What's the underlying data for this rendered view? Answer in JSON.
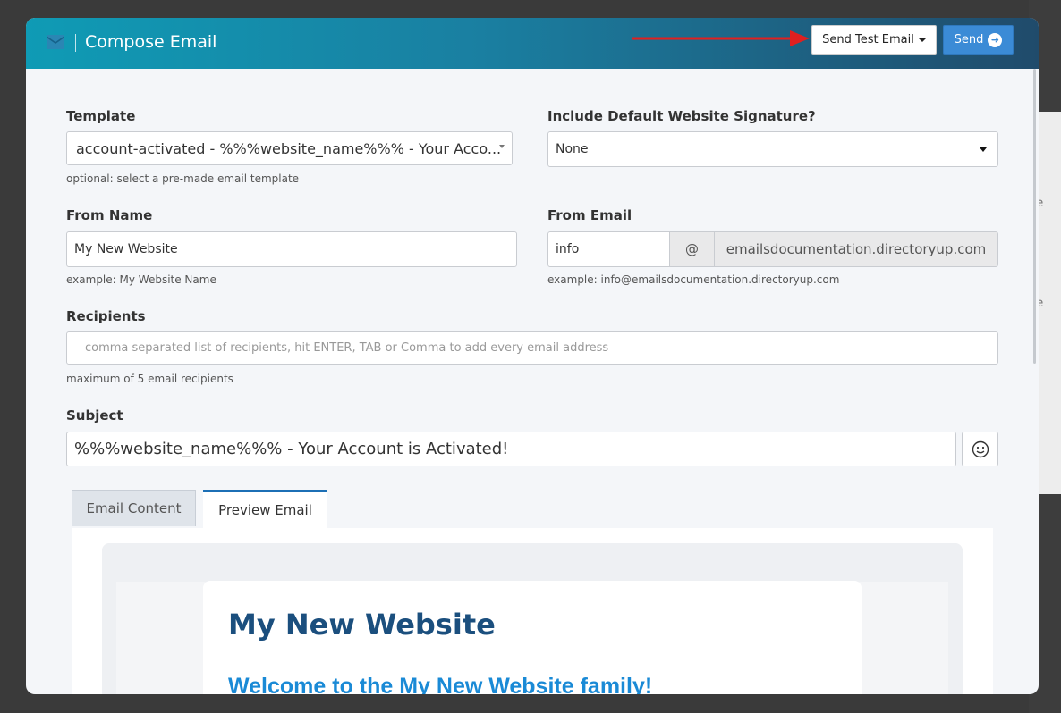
{
  "background": {
    "fragments": [
      "ge",
      "ne"
    ]
  },
  "header": {
    "title": "Compose Email",
    "send_test_label": "Send Test Email",
    "send_label": "Send"
  },
  "template": {
    "label": "Template",
    "value": "account-activated - %%%website_name%%% - Your Acco...",
    "help": "optional: select a pre-made email template"
  },
  "signature": {
    "label": "Include Default Website Signature?",
    "value": "None"
  },
  "from_name": {
    "label": "From Name",
    "value": "My New Website",
    "help": "example: My Website Name"
  },
  "from_email": {
    "label": "From Email",
    "local": "info",
    "at": "@",
    "domain": "emailsdocumentation.directoryup.com",
    "help": "example: info@emailsdocumentation.directoryup.com"
  },
  "recipients": {
    "label": "Recipients",
    "placeholder": "comma separated list of recipients, hit ENTER, TAB or Comma to add every email address",
    "help": "maximum of 5 email recipients"
  },
  "subject": {
    "label": "Subject",
    "value": "%%%website_name%%% - Your Account is Activated!"
  },
  "tabs": [
    {
      "label": "Email Content",
      "active": false
    },
    {
      "label": "Preview Email",
      "active": true
    }
  ],
  "preview": {
    "site_name": "My New Website",
    "welcome": "Welcome to the My New Website family!"
  },
  "icons": [
    "envelope-icon",
    "chevron-down-icon",
    "arrow-right-circle-icon",
    "emoji-smile-icon",
    "red-arrow-annotation"
  ],
  "colors": {
    "header_start": "#0f9bb5",
    "header_end": "#204b6b",
    "send_button": "#3b8bd6",
    "annotation": "#e02020",
    "link_blue": "#1a8ad6",
    "heading_navy": "#1b4f7e"
  }
}
